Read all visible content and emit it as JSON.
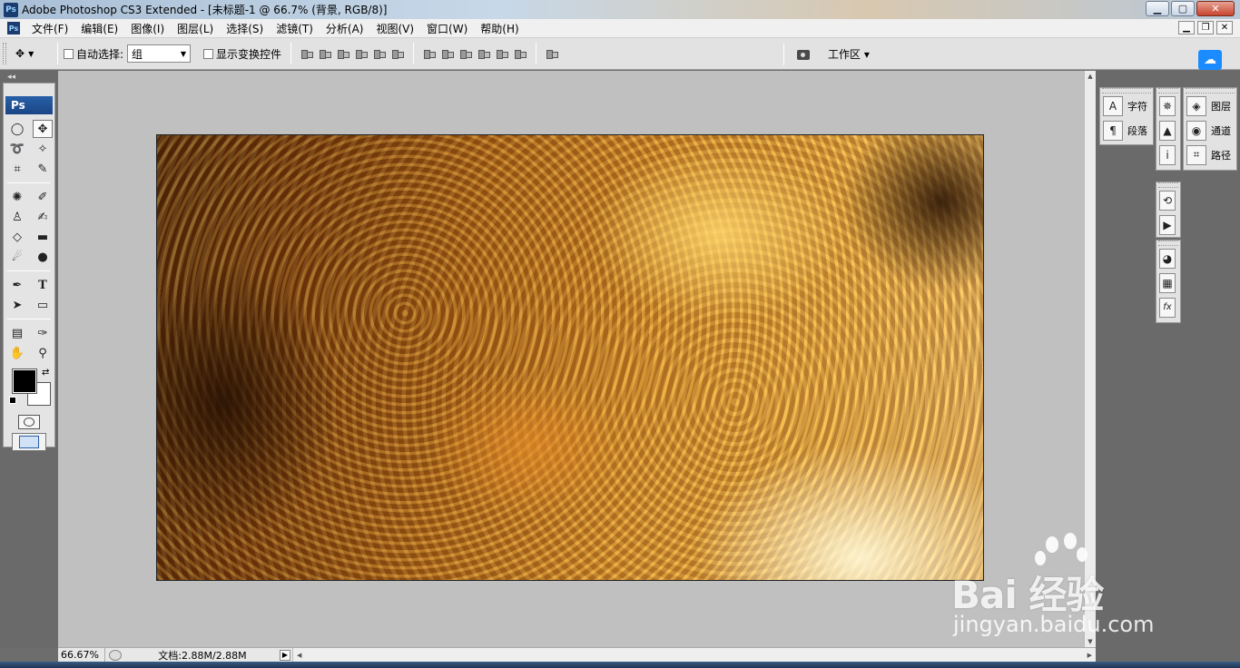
{
  "window": {
    "title": "Adobe Photoshop CS3 Extended - [未标题-1 @ 66.7% (背景, RGB/8)]",
    "app_icon": "Ps"
  },
  "menu": [
    "文件(F)",
    "编辑(E)",
    "图像(I)",
    "图层(L)",
    "选择(S)",
    "滤镜(T)",
    "分析(A)",
    "视图(V)",
    "窗口(W)",
    "帮助(H)"
  ],
  "options": {
    "auto_select_label": "自动选择:",
    "auto_select_checked": false,
    "auto_select_value": "组",
    "show_transform_label": "显示变换控件",
    "show_transform_checked": false,
    "workspace_label": "工作区 ▾"
  },
  "toolbox": {
    "logo": "Ps",
    "foreground_color": "#000000",
    "background_color": "#ffffff"
  },
  "canvas": {
    "description_hidden": "amber liquid texture"
  },
  "status": {
    "zoom": "66.67%",
    "doc_info": "文档:2.88M/2.88M"
  },
  "panels": {
    "col1": [
      {
        "icon": "character-icon",
        "glyph": "A",
        "label": "字符"
      },
      {
        "icon": "paragraph-icon",
        "glyph": "¶",
        "label": "段落"
      }
    ],
    "col2": [
      {
        "icon": "navigator-icon",
        "glyph": "✵"
      },
      {
        "icon": "histogram-icon",
        "glyph": "▲"
      },
      {
        "icon": "info-icon",
        "glyph": "i"
      },
      {
        "icon": "history-icon",
        "glyph": "⟲"
      },
      {
        "icon": "actions-icon",
        "glyph": "▶"
      },
      {
        "icon": "color-icon",
        "glyph": "◕"
      },
      {
        "icon": "swatches-icon",
        "glyph": "▦"
      },
      {
        "icon": "styles-icon",
        "glyph": "fx"
      }
    ],
    "col3": [
      {
        "icon": "layers-icon",
        "glyph": "◈",
        "label": "图层"
      },
      {
        "icon": "channels-icon",
        "glyph": "◉",
        "label": "通道"
      },
      {
        "icon": "paths-icon",
        "glyph": "⌗",
        "label": "路径"
      }
    ]
  },
  "watermark": {
    "brand": "Bai  经验",
    "url": "jingyan.baidu.com"
  }
}
